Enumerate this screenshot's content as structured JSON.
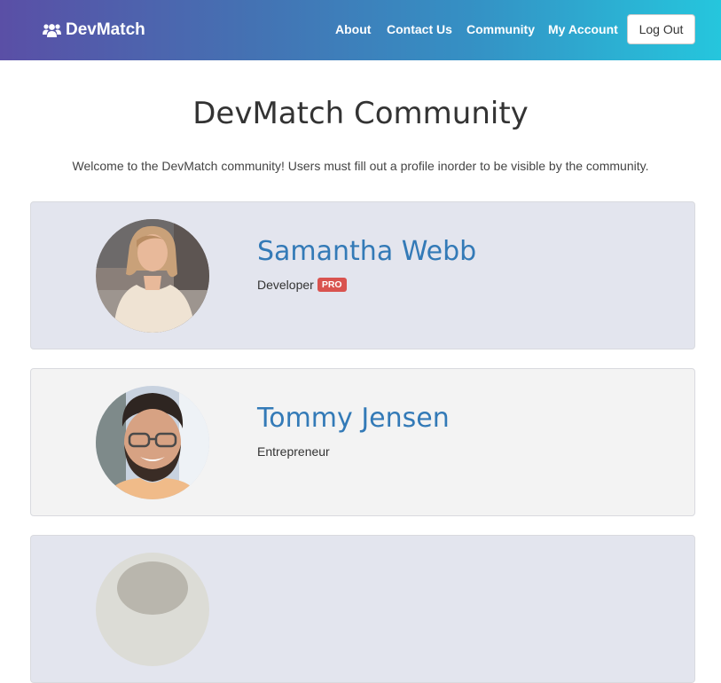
{
  "navbar": {
    "brand": "DevMatch",
    "brand_icon": "users-icon",
    "links": [
      {
        "label": "About"
      },
      {
        "label": "Contact Us"
      },
      {
        "label": "Community"
      },
      {
        "label": "My Account"
      }
    ],
    "logout_label": "Log Out"
  },
  "page": {
    "title": "DevMatch Community",
    "intro": "Welcome to the DevMatch community! Users must fill out a profile inorder to be visible by the community."
  },
  "profiles": [
    {
      "name": "Samantha Webb",
      "role": "Developer",
      "badge": "PRO"
    },
    {
      "name": "Tommy Jensen",
      "role": "Entrepreneur"
    }
  ],
  "colors": {
    "link": "#337ab7",
    "pro_badge": "#d9534f",
    "card_alt": "#e3e5ee",
    "card": "#f3f3f3"
  }
}
